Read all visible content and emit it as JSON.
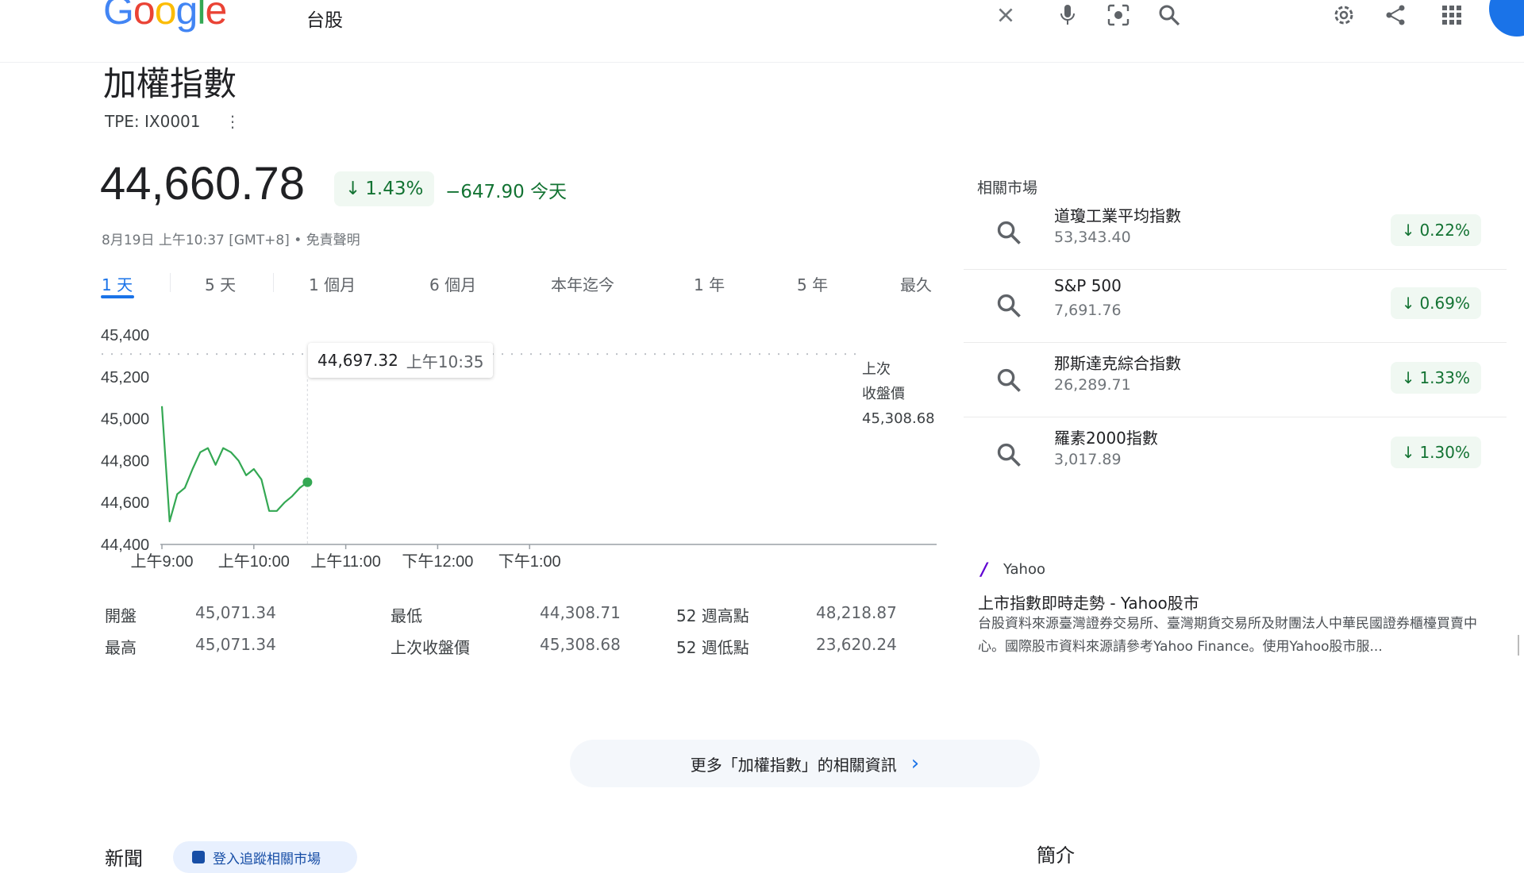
{
  "search": {
    "query": "台股"
  },
  "header_icons": [
    "close-icon",
    "mic-icon",
    "lens-icon",
    "search-icon",
    "settings-icon",
    "share-icon",
    "apps-icon"
  ],
  "stock": {
    "name": "加權指數",
    "ticker": "TPE: IX0001",
    "price": "44,660.78",
    "change_pct": "1.43%",
    "change_abs": "−647.90 今天",
    "timestamp": "8月19日 上午10:37 [GMT+8] • 免責聲明",
    "direction": "down",
    "color_down": "#137333"
  },
  "range_tabs": [
    {
      "label": "1 天",
      "active": true
    },
    {
      "label": "5 天",
      "active": false
    },
    {
      "label": "1 個月",
      "active": false
    },
    {
      "label": "6 個月",
      "active": false
    },
    {
      "label": "本年迄今",
      "active": false
    },
    {
      "label": "1 年",
      "active": false
    },
    {
      "label": "5 年",
      "active": false
    },
    {
      "label": "最久",
      "active": false
    }
  ],
  "chart_data": {
    "type": "line",
    "ylim": [
      44400,
      45400
    ],
    "y_ticks": [
      "45,400",
      "45,200",
      "45,000",
      "44,800",
      "44,600",
      "44,400"
    ],
    "x_ticks": [
      "上午9:00",
      "上午10:00",
      "上午11:00",
      "下午12:00",
      "下午1:00"
    ],
    "x_domain_minutes": [
      0,
      300
    ],
    "x": [
      "09:00",
      "09:05",
      "09:10",
      "09:15",
      "09:20",
      "09:25",
      "09:30",
      "09:35",
      "09:40",
      "09:45",
      "09:50",
      "09:55",
      "10:00",
      "10:05",
      "10:10",
      "10:15",
      "10:20",
      "10:25",
      "10:30",
      "10:35"
    ],
    "series": [
      {
        "values": [
          45060,
          44510,
          44640,
          44670,
          44760,
          44840,
          44860,
          44780,
          44860,
          44840,
          44800,
          44730,
          44760,
          44710,
          44560,
          44560,
          44600,
          44630,
          44670,
          44697
        ]
      }
    ],
    "previous_close": 45308.68,
    "previous_close_label": [
      "上次",
      "收盤價",
      "45,308.68"
    ],
    "tooltip": {
      "value": "44,697.32",
      "time": "上午10:35"
    },
    "line_color": "#34a853"
  },
  "stats": [
    {
      "label": "開盤",
      "value": "45,071.34"
    },
    {
      "label": "最高",
      "value": "45,071.34"
    },
    {
      "label": "最低",
      "value": "44,308.71"
    },
    {
      "label": "上次收盤價",
      "value": "45,308.68"
    },
    {
      "label": "52 週高點",
      "value": "48,218.87"
    },
    {
      "label": "52 週低點",
      "value": "23,620.24"
    }
  ],
  "related": {
    "title": "相關市場",
    "items": [
      {
        "name": "道瓊工業平均指數",
        "price": "53,343.40",
        "change": "0.22%"
      },
      {
        "name": "S&P 500",
        "price": "7,691.76",
        "change": "0.69%"
      },
      {
        "name": "那斯達克綜合指數",
        "price": "26,289.71",
        "change": "1.33%"
      },
      {
        "name": "羅素2000指數",
        "price": "3,017.89",
        "change": "1.30%"
      }
    ]
  },
  "news_source": {
    "source": "Yahoo",
    "title": "上市指數即時走勢 - Yahoo股市",
    "snippet": "台股資料來源臺灣證券交易所、臺灣期貨交易所及財團法人中華民國證券櫃檯買賣中心。國際股市資料來源請參考Yahoo Finance。使用Yahoo股市服..."
  },
  "more_button": "更多「加權指數」的相關資訊",
  "bottom": {
    "news_heading": "新聞",
    "chip": "登入追蹤相關市場",
    "intro_heading": "簡介"
  }
}
